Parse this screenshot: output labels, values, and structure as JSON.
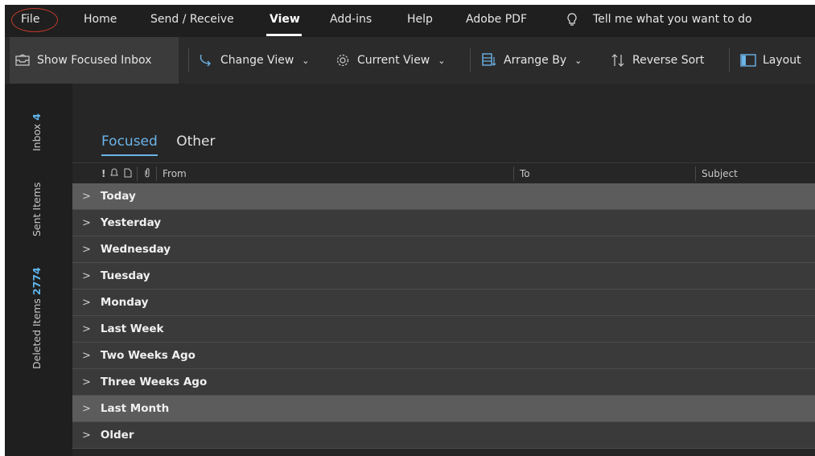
{
  "menu": {
    "file": "File",
    "home": "Home",
    "send_receive": "Send / Receive",
    "view": "View",
    "addins": "Add-ins",
    "help": "Help",
    "adobe_pdf": "Adobe PDF",
    "tell_me": "Tell me what you want to do"
  },
  "toolbar": {
    "show_focused": "Show Focused Inbox",
    "change_view": "Change View",
    "current_view": "Current View",
    "arrange_by": "Arrange By",
    "reverse_sort": "Reverse Sort",
    "layout": "Layout"
  },
  "leftnav": {
    "inbox_label": "Inbox",
    "inbox_count": "4",
    "sent_label": "Sent Items",
    "deleted_label": "Deleted Items",
    "deleted_count": "2774"
  },
  "tabs": {
    "focused": "Focused",
    "other": "Other"
  },
  "columns": {
    "importance": "!",
    "from": "From",
    "to": "To",
    "subject": "Subject"
  },
  "groups": [
    "Today",
    "Yesterday",
    "Wednesday",
    "Tuesday",
    "Monday",
    "Last Week",
    "Two Weeks Ago",
    "Three Weeks Ago",
    "Last Month",
    "Older"
  ],
  "colors": {
    "accent": "#6cb4e8",
    "annotation": "#c0392b"
  }
}
